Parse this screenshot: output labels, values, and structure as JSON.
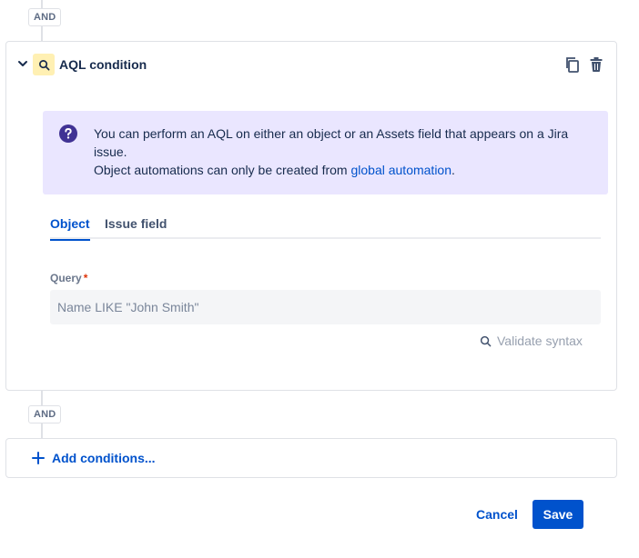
{
  "connectors": {
    "top_label": "AND",
    "bottom_label": "AND"
  },
  "condition_card": {
    "title": "AQL condition",
    "icon": "search-icon",
    "accent_color": "#fff0b3",
    "info": {
      "line1": "You can perform an AQL on either an object or an Assets field that appears on a Jira issue.",
      "line2_prefix": "Object automations can only be created from ",
      "line2_link": "global automation",
      "line2_suffix": ".",
      "background": "#eae6ff"
    },
    "tabs": [
      {
        "label": "Object",
        "active": true
      },
      {
        "label": "Issue field",
        "active": false
      }
    ],
    "query": {
      "label": "Query",
      "required_marker": "*",
      "value": "",
      "placeholder": "Name LIKE \"John Smith\""
    },
    "validate_label": "Validate syntax"
  },
  "add_conditions": {
    "label": "Add conditions..."
  },
  "footer": {
    "cancel_label": "Cancel",
    "save_label": "Save",
    "primary_color": "#0052cc"
  }
}
